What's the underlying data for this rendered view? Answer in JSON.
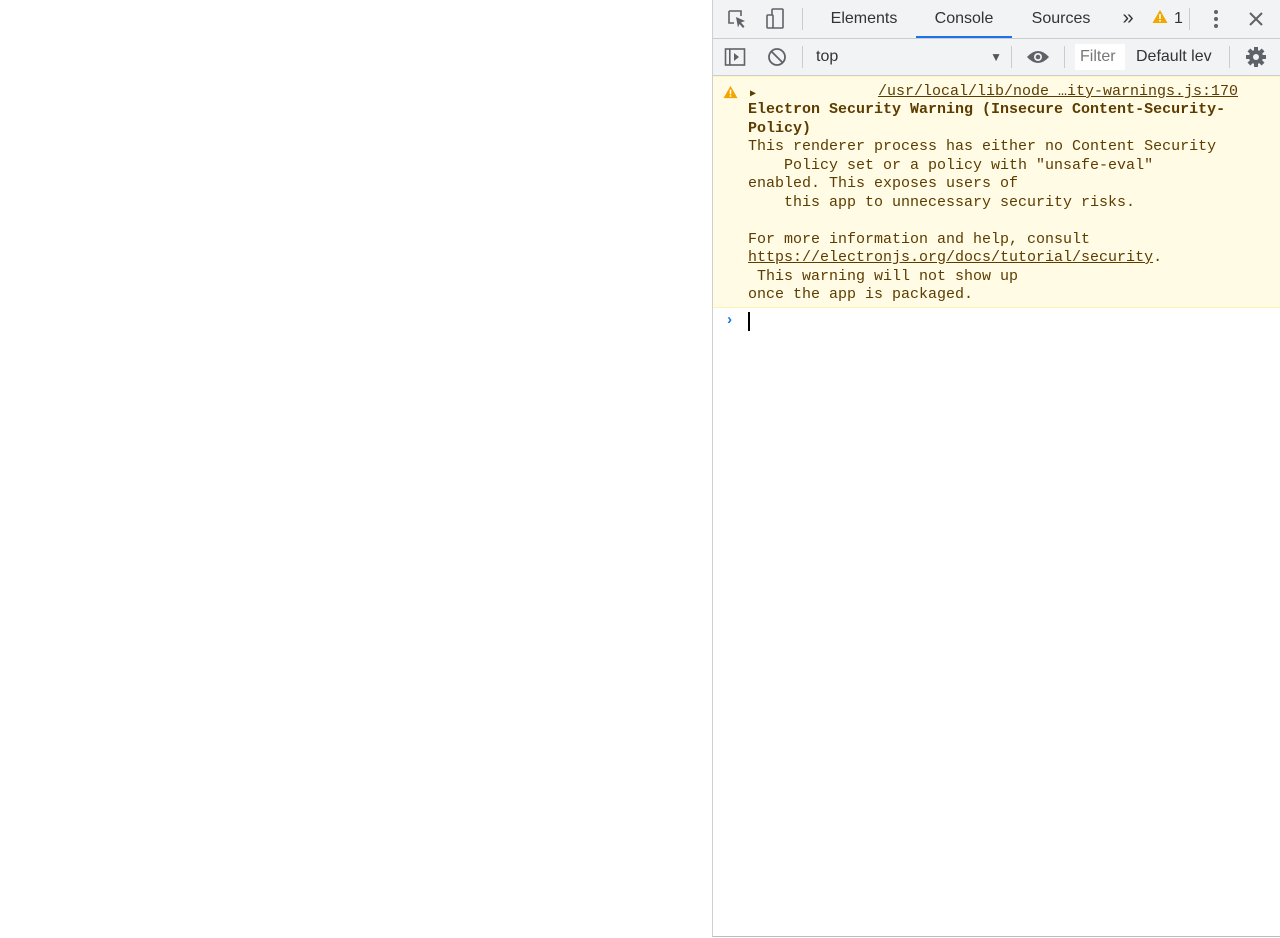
{
  "tabs": [
    {
      "label": "Elements"
    },
    {
      "label": "Console"
    },
    {
      "label": "Sources"
    }
  ],
  "tabbar": {
    "more_tabs": "»",
    "warning_count": "1"
  },
  "toolbar": {
    "context": "top",
    "filter_placeholder": "Filter",
    "levels": "Default lev"
  },
  "console": {
    "warning": {
      "source": "/usr/local/lib/node …ity-warnings.js:170",
      "title_line1": "Electron Security Warning (Insecure Content-Security-",
      "title_line2": "Policy)",
      "body_line1": "This renderer process has either no Content Security",
      "body_line2": "    Policy set or a policy with \"unsafe-eval\"",
      "body_line3": "enabled. This exposes users of",
      "body_line4": "    this app to unnecessary security risks.",
      "body_line5": "For more information and help, consult",
      "link": "https://electronjs.org/docs/tutorial/security",
      "link_suffix": ".",
      "body_line6": " This warning will not show up",
      "body_line7": "once the app is packaged."
    },
    "prompt": "›"
  },
  "colors": {
    "accent": "#1a73e8",
    "warning_bg": "#fffbe5",
    "warning_text": "#5c3c00",
    "warning_icon": "#f2a600"
  }
}
